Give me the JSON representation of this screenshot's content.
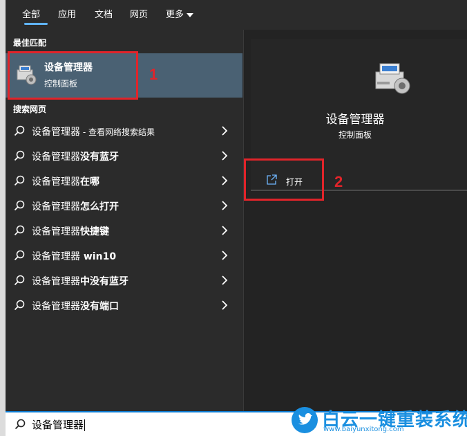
{
  "tabs": [
    {
      "label": "全部",
      "active": true
    },
    {
      "label": "应用"
    },
    {
      "label": "文档"
    },
    {
      "label": "网页"
    },
    {
      "label": "更多"
    }
  ],
  "best_match": {
    "section_title": "最佳匹配",
    "title": "设备管理器",
    "subtitle": "控制面板",
    "icon": "device-manager-icon"
  },
  "web": {
    "section_title": "搜索网页",
    "items": [
      {
        "prefix": "设备管理器",
        "suffix": " - 查看网络搜索结果"
      },
      {
        "prefix": "设备管理器",
        "suffix": "没有蓝牙"
      },
      {
        "prefix": "设备管理器",
        "suffix": "在哪"
      },
      {
        "prefix": "设备管理器",
        "suffix": "怎么打开"
      },
      {
        "prefix": "设备管理器",
        "suffix": "快捷键"
      },
      {
        "prefix": "设备管理器",
        "suffix": " win10"
      },
      {
        "prefix": "设备管理器",
        "suffix": "中没有蓝牙"
      },
      {
        "prefix": "设备管理器",
        "suffix": "没有端口"
      }
    ]
  },
  "preview": {
    "title": "设备管理器",
    "subtitle": "控制面板",
    "open_label": "打开"
  },
  "annotations": {
    "marker1": "1",
    "marker2": "2"
  },
  "search": {
    "value": "设备管理器"
  },
  "watermark": {
    "main": "白云一键重装系统",
    "url": "www.baiyunxitong.com"
  },
  "colors": {
    "accent": "#60b4ff",
    "highlight": "#4a6173",
    "annotation": "#e1242a",
    "watermark": "#1a8fe0"
  }
}
